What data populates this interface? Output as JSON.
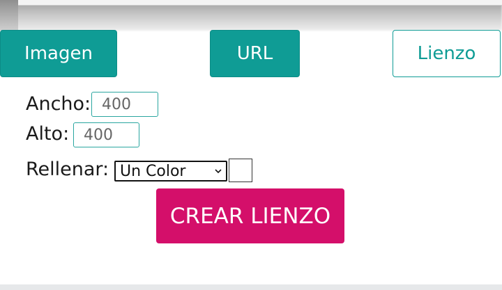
{
  "tabs": {
    "imagen": "Imagen",
    "url": "URL",
    "lienzo": "Lienzo"
  },
  "form": {
    "ancho_label": "Ancho:",
    "ancho_value": "400",
    "alto_label": "Alto:",
    "alto_value": "400",
    "rellenar_label": "Rellenar:",
    "rellenar_selected": "Un Color"
  },
  "create_button_label": "CREAR LIENZO",
  "colors": {
    "teal": "#0f9c95",
    "magenta": "#d40f6a"
  },
  "icons": {
    "dropdown": "chevron-down-icon"
  }
}
